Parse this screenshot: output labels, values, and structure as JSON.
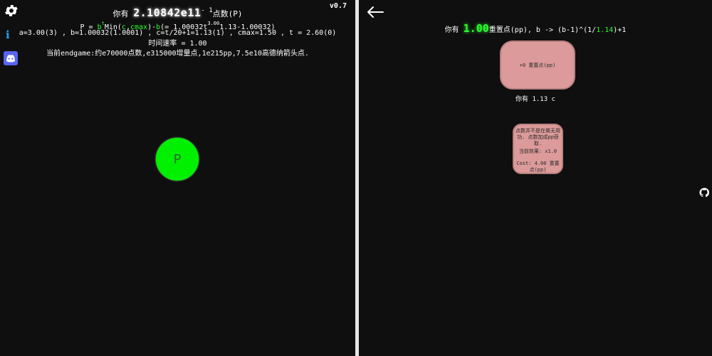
{
  "header": {
    "version": "v0.7",
    "points_prefix": "你有",
    "points_value": "2.10842e11",
    "points_exp": "- 1",
    "points_suffix": "点数(P)",
    "formula_a": "P = ",
    "formula_b": "b",
    "formula_t": "t",
    "formula_mid": "Min(",
    "formula_c": "c",
    "formula_comma": ",",
    "formula_cmax": "cmax",
    "formula_close": ")-",
    "formula_b2": "b",
    "formula_rest": "(= 1.00032t",
    "formula_sup": "3.00",
    "formula_tail": "1.13-1.00032)",
    "vars": "a=3.00(3) , b=1.00032(1.0001) , c=t/20+1=1.13(1) , cmax=1.50 , t = 2.60(0)",
    "rate": "时间速率 = 1.00",
    "endgame": "当前endgame:约e70000点数,e315000增量点,1e215pp,7.5e10高德纳箭头点."
  },
  "main_button": {
    "label": "P"
  },
  "reset": {
    "prefix": "你有",
    "pp_value": "1.00",
    "text_mid": "重置点(pp), b -> (b-1)^(1/",
    "green_part": "1.14",
    "text_end": ")+1",
    "button_label": "+0 重置点(pp)",
    "c_line": "你有 1.13 c"
  },
  "upgrade": {
    "desc": "点数并不是在做无用功. 点数加成pp获取.",
    "effect": "当前效果:  x1.0",
    "cost": "Cost: 4.00 重置点(pp)"
  },
  "icons": {
    "settings": "gear-icon",
    "info": "info-icon",
    "discord": "discord-icon",
    "back": "back-arrow-icon",
    "github": "github-icon"
  },
  "colors": {
    "background": "#0f0f0f",
    "accent_green": "#2bff2b",
    "button_green": "#00f000",
    "upgrade_pink": "#dc9a9a",
    "info_blue": "#1fa3ff",
    "discord_blue": "#5865f2"
  }
}
